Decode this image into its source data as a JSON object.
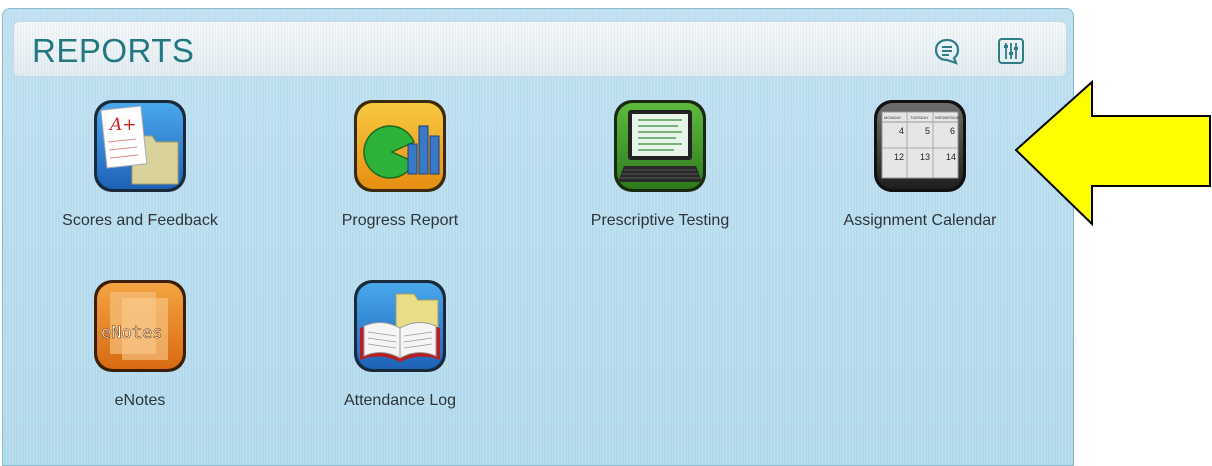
{
  "header": {
    "title": "REPORTS",
    "icons": [
      "chat-icon",
      "settings-sliders-icon"
    ]
  },
  "tiles": [
    {
      "label": "Scores and Feedback",
      "icon": "scores-feedback-icon"
    },
    {
      "label": "Progress Report",
      "icon": "progress-report-icon"
    },
    {
      "label": "Prescriptive Testing",
      "icon": "prescriptive-testing-icon"
    },
    {
      "label": "Assignment Calendar",
      "icon": "assignment-calendar-icon"
    },
    {
      "label": "eNotes",
      "icon": "enotes-icon"
    },
    {
      "label": "Attendance Log",
      "icon": "attendance-log-icon"
    }
  ],
  "calendar": {
    "days": [
      "MONDAY",
      "TUESDAY",
      "WEDNESDAY"
    ],
    "dates": [
      "4",
      "5",
      "6",
      "12",
      "13",
      "14"
    ]
  },
  "enotes_text": "eNotes",
  "score_text": "A+",
  "colors": {
    "title": "#23777f",
    "panel": "#b6dbee",
    "arrow": "#ffff00"
  }
}
